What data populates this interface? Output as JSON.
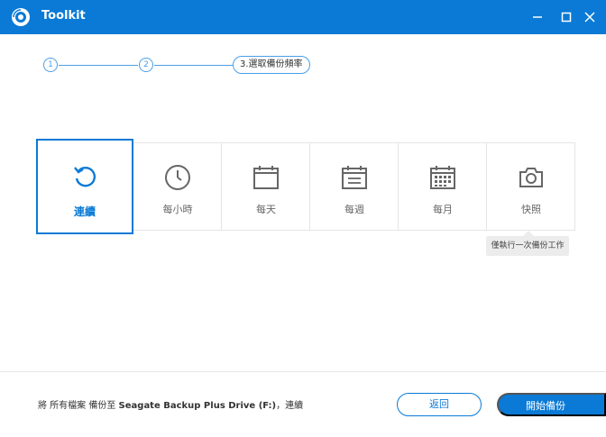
{
  "window": {
    "title": "Toolkit",
    "accent_color": "#0a7ad6",
    "logo_icon": "toolkit-logo-icon",
    "controls": [
      "minimize-icon",
      "maximize-icon",
      "close-icon"
    ]
  },
  "stepper": {
    "step1": "1",
    "step2": "2",
    "current": "3.選取備份頻率"
  },
  "frequency_options": [
    {
      "label": "連續",
      "icon": "continuous-refresh-icon",
      "selected": true
    },
    {
      "label": "每小時",
      "icon": "clock-icon",
      "selected": false
    },
    {
      "label": "每天",
      "icon": "calendar-day-icon",
      "selected": false
    },
    {
      "label": "每週",
      "icon": "calendar-week-icon",
      "selected": false
    },
    {
      "label": "每月",
      "icon": "calendar-month-icon",
      "selected": false
    },
    {
      "label": "快照",
      "icon": "camera-icon",
      "selected": false
    }
  ],
  "tooltip": "僅執行一次備份工作",
  "footer": {
    "summary_prefix": "將 所有檔案 備份至 ",
    "summary_drive": "Seagate Backup Plus Drive (F:)",
    "summary_suffix": "，連續",
    "back_label": "返回",
    "next_label": "開始備份"
  }
}
